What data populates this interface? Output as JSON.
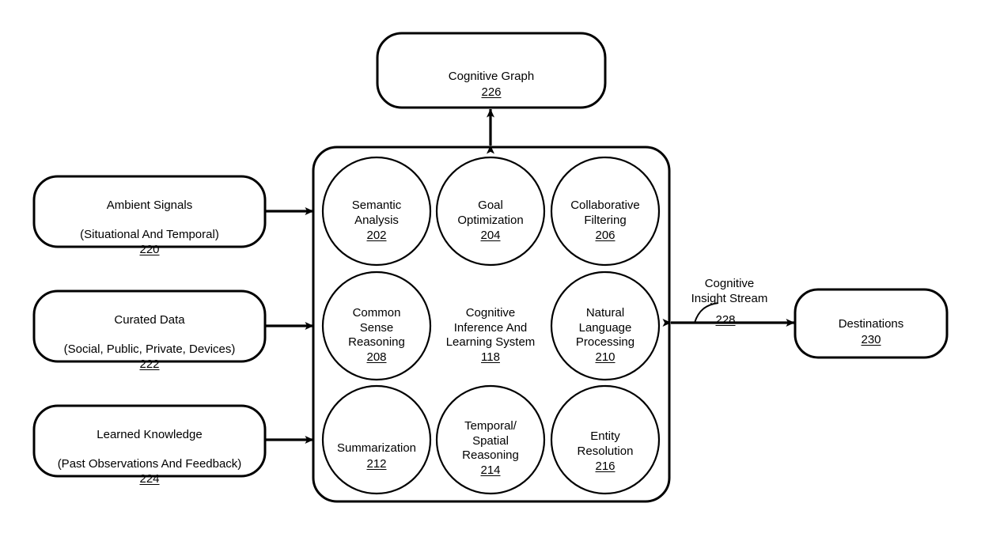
{
  "figure": {
    "type": "patent-block-diagram",
    "background_color": "#ffffff",
    "line_color": "#000000"
  },
  "top_node": {
    "label": "Cognitive Graph",
    "ref": "226"
  },
  "inputs": [
    {
      "line1": "Ambient Signals",
      "line2": "(Situational And Temporal)",
      "ref": "220"
    },
    {
      "line1": "Curated Data",
      "line2": "(Social, Public, Private, Devices)",
      "ref": "222"
    },
    {
      "line1": "Learned Knowledge",
      "line2": "(Past Observations And Feedback)",
      "ref": "224"
    }
  ],
  "system": {
    "center_label": "Cognitive\nInference And\nLearning System",
    "center_ref": "118",
    "components": [
      {
        "label": "Semantic\nAnalysis",
        "ref": "202"
      },
      {
        "label": "Goal\nOptimization",
        "ref": "204"
      },
      {
        "label": "Collaborative\nFiltering",
        "ref": "206"
      },
      {
        "label": "Common\nSense\nReasoning",
        "ref": "208"
      },
      {
        "label": "Natural\nLanguage\nProcessing",
        "ref": "210"
      },
      {
        "label": "Summarization",
        "ref": "212"
      },
      {
        "label": "Temporal/\nSpatial\nReasoning",
        "ref": "214"
      },
      {
        "label": "Entity\nResolution",
        "ref": "216"
      }
    ]
  },
  "stream": {
    "label": "Cognitive\nInsight Stream",
    "ref": "228"
  },
  "destination": {
    "label": "Destinations",
    "ref": "230"
  }
}
